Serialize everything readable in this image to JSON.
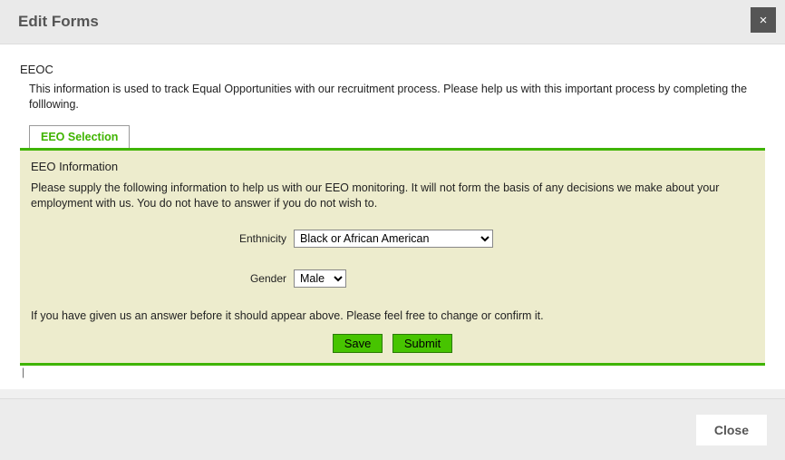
{
  "header": {
    "title": "Edit Forms",
    "close_icon": "×"
  },
  "section": {
    "heading": "EEOC",
    "intro": "This information is used to track Equal Opportunities with our recruitment process. Please help us with this important process by completing the folllowing.",
    "tab_label": "EEO Selection"
  },
  "panel": {
    "title": "EEO Information",
    "description": "Please supply the following information to help us with our EEO monitoring. It will not form the basis of any decisions we make about your employment with us. You do not have to answer if you do not wish to.",
    "ethnicity_label": "Enthnicity",
    "ethnicity_value": "Black or African American",
    "gender_label": "Gender",
    "gender_value": "Male",
    "note": "If you have given us an answer before it should appear above. Please feel free to change or confirm it.",
    "save_label": "Save",
    "submit_label": "Submit"
  },
  "footer": {
    "close_label": "Close"
  },
  "colors": {
    "accent_green": "#3fb400",
    "panel_bg": "#edeccd"
  }
}
